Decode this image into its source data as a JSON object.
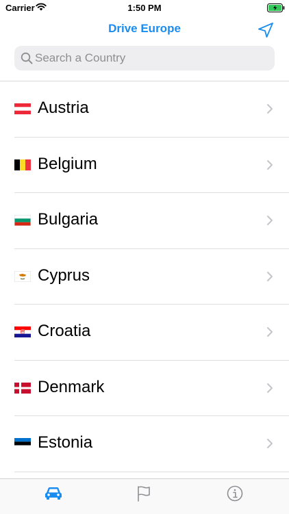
{
  "status_bar": {
    "carrier": "Carrier",
    "time": "1:50 PM"
  },
  "nav": {
    "title": "Drive Europe",
    "accent_color": "#1a8cf0"
  },
  "search": {
    "placeholder": "Search a Country",
    "value": ""
  },
  "countries": [
    {
      "name": "Austria",
      "flag": "austria-flag-icon"
    },
    {
      "name": "Belgium",
      "flag": "belgium-flag-icon"
    },
    {
      "name": "Bulgaria",
      "flag": "bulgaria-flag-icon"
    },
    {
      "name": "Cyprus",
      "flag": "cyprus-flag-icon"
    },
    {
      "name": "Croatia",
      "flag": "croatia-flag-icon"
    },
    {
      "name": "Denmark",
      "flag": "denmark-flag-icon"
    },
    {
      "name": "Estonia",
      "flag": "estonia-flag-icon"
    }
  ],
  "tab_bar": {
    "tabs": [
      {
        "icon": "car-icon",
        "selected": true
      },
      {
        "icon": "flag-icon",
        "selected": false
      },
      {
        "icon": "info-icon",
        "selected": false
      }
    ],
    "selected_color": "#1a8cf0",
    "inactive_color": "#8e8e93"
  }
}
